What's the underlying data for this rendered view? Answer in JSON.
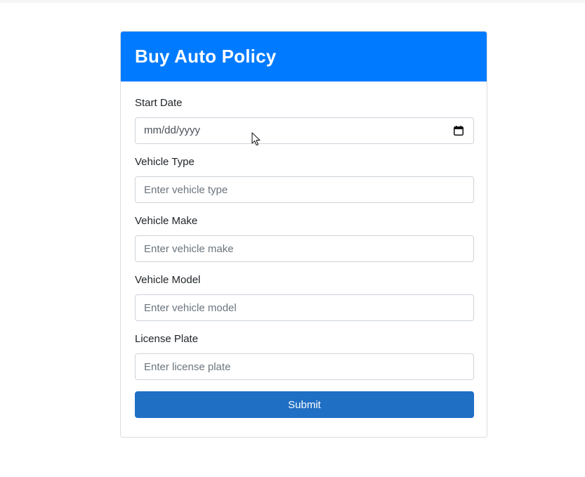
{
  "form": {
    "title": "Buy Auto Policy",
    "fields": [
      {
        "label": "Start Date",
        "value": "mm/dd/yyyy"
      },
      {
        "label": "Vehicle Type",
        "placeholder": "Enter vehicle type"
      },
      {
        "label": "Vehicle Make",
        "placeholder": "Enter vehicle make"
      },
      {
        "label": "Vehicle Model",
        "placeholder": "Enter vehicle model"
      },
      {
        "label": "License Plate",
        "placeholder": "Enter license plate"
      }
    ],
    "submit_label": "Submit"
  },
  "colors": {
    "header_bg": "#007bff",
    "button_bg": "#1f6fc4",
    "border": "#ced4da"
  },
  "icons": {
    "date_picker": "calendar-icon",
    "pointer": "mouse-cursor-icon"
  }
}
